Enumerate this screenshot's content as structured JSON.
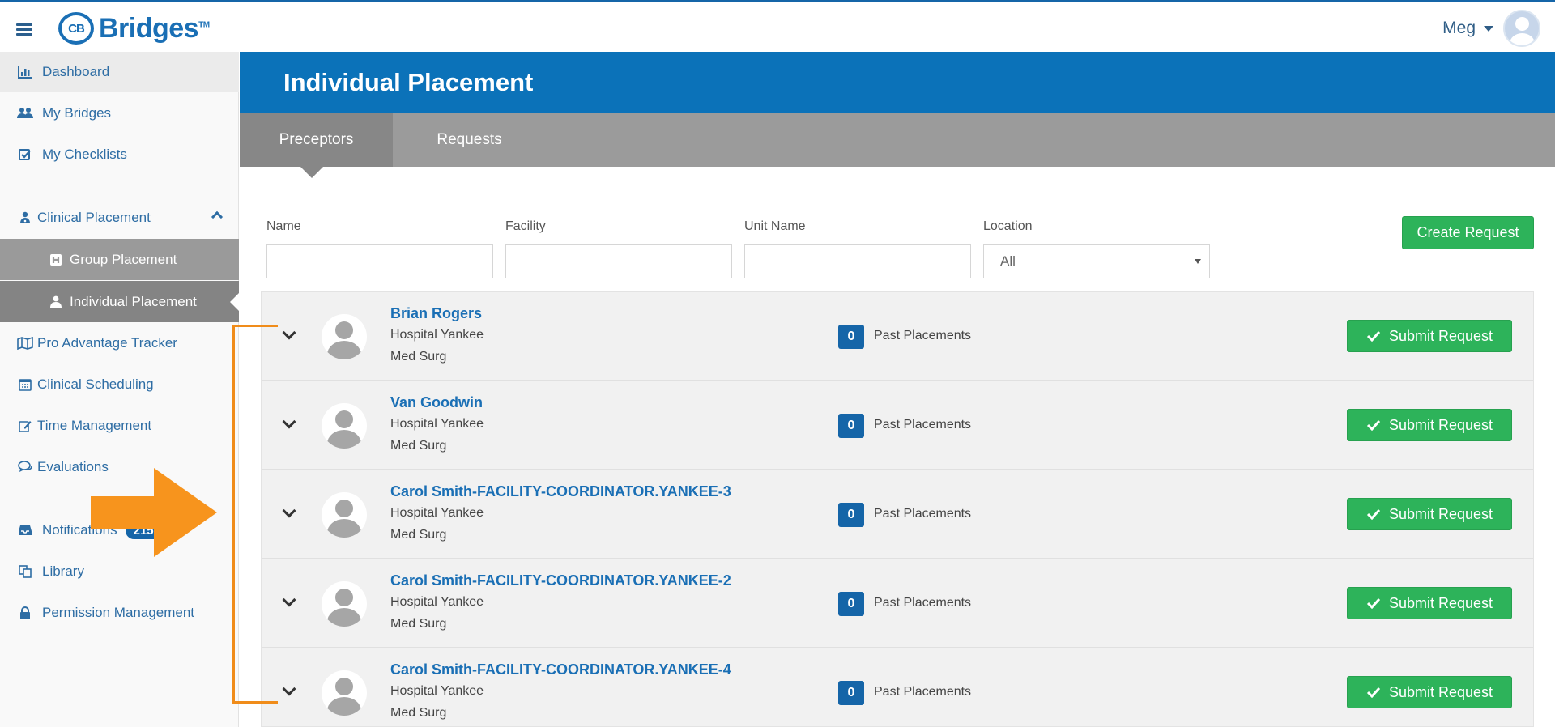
{
  "app": {
    "logo_mark": "CB",
    "logo_text": "Bridges",
    "logo_tm": "TM"
  },
  "user": {
    "name": "Meg"
  },
  "sidebar": {
    "items": [
      {
        "label": "Dashboard",
        "icon": "bar-chart-icon"
      },
      {
        "label": "My Bridges",
        "icon": "users-icon"
      },
      {
        "label": "My Checklists",
        "icon": "checkbox-icon"
      },
      {
        "label": "Clinical Placement",
        "icon": "user-doctor-icon"
      },
      {
        "label": "Group Placement",
        "icon": "h-square-icon"
      },
      {
        "label": "Individual Placement",
        "icon": "user-icon"
      },
      {
        "label": "Pro Advantage Tracker",
        "icon": "map-icon"
      },
      {
        "label": "Clinical Scheduling",
        "icon": "calendar-icon"
      },
      {
        "label": "Time Management",
        "icon": "edit-icon"
      },
      {
        "label": "Evaluations",
        "icon": "comments-icon"
      },
      {
        "label": "Notifications",
        "icon": "inbox-icon",
        "badge": "215"
      },
      {
        "label": "Library",
        "icon": "copy-icon"
      },
      {
        "label": "Permission Management",
        "icon": "lock-icon"
      }
    ]
  },
  "page": {
    "title": "Individual Placement"
  },
  "tabs": [
    {
      "label": "Preceptors"
    },
    {
      "label": "Requests"
    }
  ],
  "filters": {
    "name_label": "Name",
    "facility_label": "Facility",
    "unit_label": "Unit Name",
    "location_label": "Location",
    "location_value": "All",
    "create_button": "Create Request"
  },
  "preceptors": [
    {
      "name": "Brian Rogers",
      "facility": "Hospital Yankee",
      "unit": "Med Surg",
      "count": "0",
      "count_label": "Past Placements",
      "button": "Submit Request"
    },
    {
      "name": "Van Goodwin",
      "facility": "Hospital Yankee",
      "unit": "Med Surg",
      "count": "0",
      "count_label": "Past Placements",
      "button": "Submit Request"
    },
    {
      "name": "Carol Smith-FACILITY-COORDINATOR.YANKEE-3",
      "facility": "Hospital Yankee",
      "unit": "Med Surg",
      "count": "0",
      "count_label": "Past Placements",
      "button": "Submit Request"
    },
    {
      "name": "Carol Smith-FACILITY-COORDINATOR.YANKEE-2",
      "facility": "Hospital Yankee",
      "unit": "Med Surg",
      "count": "0",
      "count_label": "Past Placements",
      "button": "Submit Request"
    },
    {
      "name": "Carol Smith-FACILITY-COORDINATOR.YANKEE-4",
      "facility": "Hospital Yankee",
      "unit": "Med Surg",
      "count": "0",
      "count_label": "Past Placements",
      "button": "Submit Request"
    }
  ],
  "colors": {
    "brand": "#0b72b9",
    "success": "#2db35a",
    "annotation": "#f08c1a"
  }
}
